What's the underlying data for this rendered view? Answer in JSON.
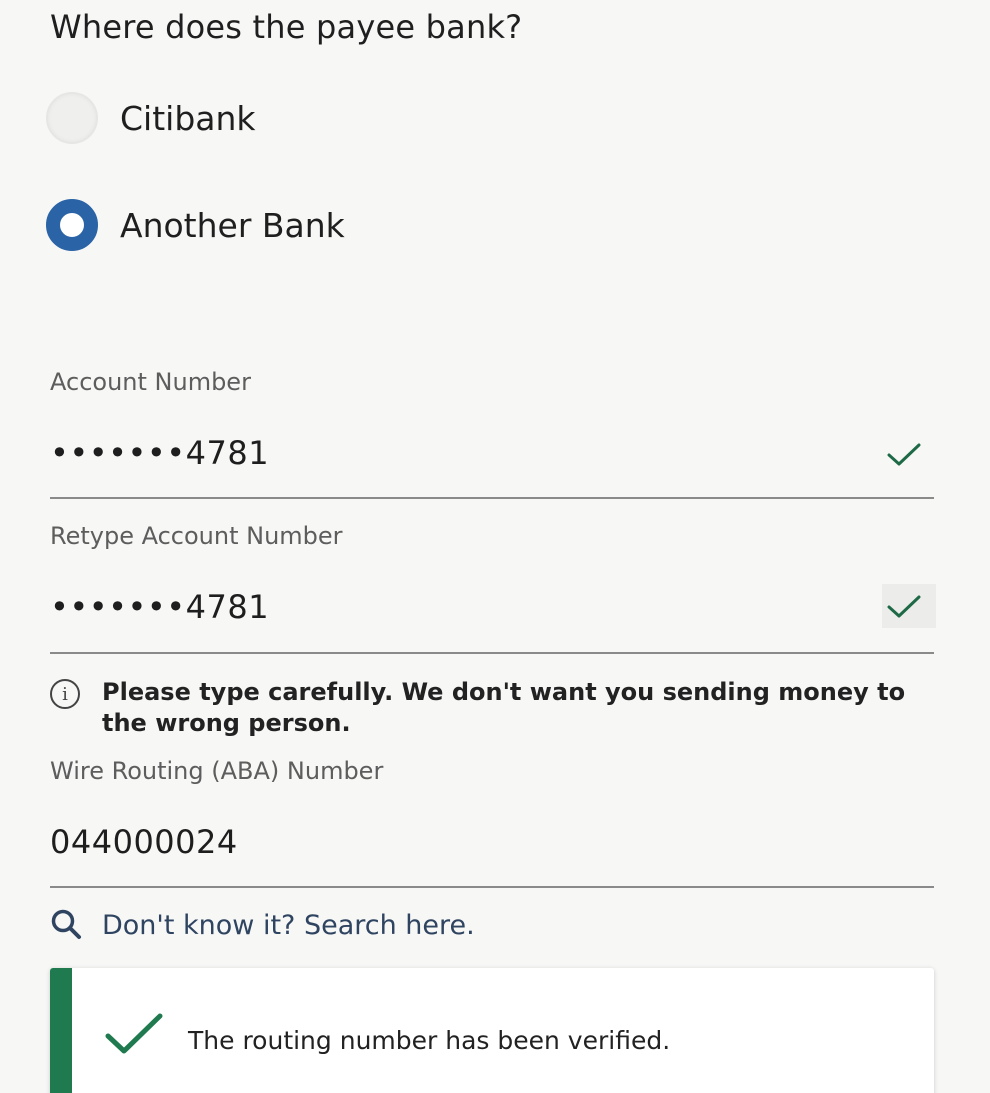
{
  "question": "Where does the payee bank?",
  "bank_options": [
    {
      "label": "Citibank",
      "selected": false
    },
    {
      "label": "Another Bank",
      "selected": true
    }
  ],
  "account_number": {
    "label": "Account Number",
    "value": "•••••••4781",
    "status_icon": "checkmark-icon"
  },
  "retype_account_number": {
    "label": "Retype Account Number",
    "value": "•••••••4781",
    "status_icon": "checkmark-icon"
  },
  "info_message": {
    "icon": "info-icon",
    "icon_glyph": "i",
    "text": "Please type carefully. We don't want you sending money to the wrong person."
  },
  "routing_number": {
    "label": "Wire Routing (ABA) Number",
    "value": "044000024"
  },
  "search_link": {
    "icon": "search-icon",
    "text": "Don't know it? Search here."
  },
  "verification_alert": {
    "icon": "checkmark-icon",
    "text": "The routing number has been verified."
  },
  "colors": {
    "primary_blue": "#2a63a6",
    "success_green": "#1f7a4f",
    "link_navy": "#2f4460"
  }
}
